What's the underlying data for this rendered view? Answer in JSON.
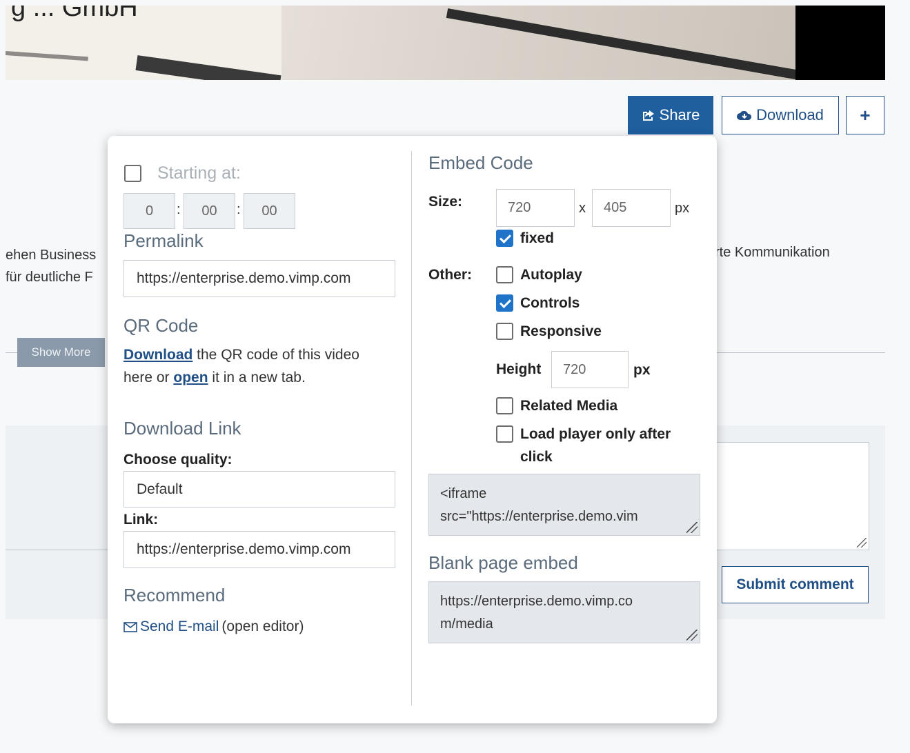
{
  "page": {
    "title_fragment": "g ... GmbH",
    "share_label": "Share",
    "download_label": "Download",
    "plus_label": "+",
    "desc_left_line1": "ehen Business",
    "desc_left_line2": "für deutliche F",
    "desc_right": "rte Kommunikation",
    "show_more_label": "Show More",
    "submit_comment_label": "Submit comment"
  },
  "share": {
    "starting_at_label": "Starting at:",
    "starting_at_checked": false,
    "time": {
      "hours": "0",
      "minutes": "00",
      "seconds": "00",
      "sep": ":"
    },
    "permalink_title": "Permalink",
    "permalink_value": "https://enterprise.demo.vimp.com",
    "qr_title": "QR Code",
    "qr_download_link": "Download",
    "qr_text_mid": "the QR code of this video",
    "qr_text_line2_start": "here or",
    "qr_open_link": "open",
    "qr_text_end": "it in a new tab.",
    "download_link_title": "Download Link",
    "choose_quality_label": "Choose quality:",
    "quality_value": "Default",
    "link_label": "Link:",
    "link_value": "https://enterprise.demo.vimp.com",
    "recommend_title": "Recommend",
    "send_email_label": "Send E-mail",
    "open_editor_label": "(open editor)"
  },
  "embed": {
    "title": "Embed Code",
    "size_label": "Size:",
    "width_value": "720",
    "times": "x",
    "height_value": "405",
    "unit_px": "px",
    "fixed_label": "fixed",
    "fixed_checked": true,
    "other_label": "Other:",
    "autoplay_label": "Autoplay",
    "autoplay_checked": false,
    "controls_label": "Controls",
    "controls_checked": true,
    "responsive_label": "Responsive",
    "responsive_checked": false,
    "height_label": "Height",
    "responsive_height_value": "720",
    "height_unit": "px",
    "related_media_label": "Related Media",
    "related_media_checked": false,
    "load_after_click_line1": "Load player only after",
    "load_after_click_line2": "click",
    "load_after_click_checked": false,
    "code_line1": "<iframe",
    "code_line2": "src=\"https://enterprise.demo.vim",
    "blank_page_title": "Blank page embed",
    "blank_line1": "https://enterprise.demo.vimp.co",
    "blank_line2": "m/media"
  },
  "colors": {
    "primary": "#1f5f9e",
    "link": "#1f4f86",
    "checkbox_checked": "#1f73c9",
    "section_title": "#5a6b7c"
  }
}
